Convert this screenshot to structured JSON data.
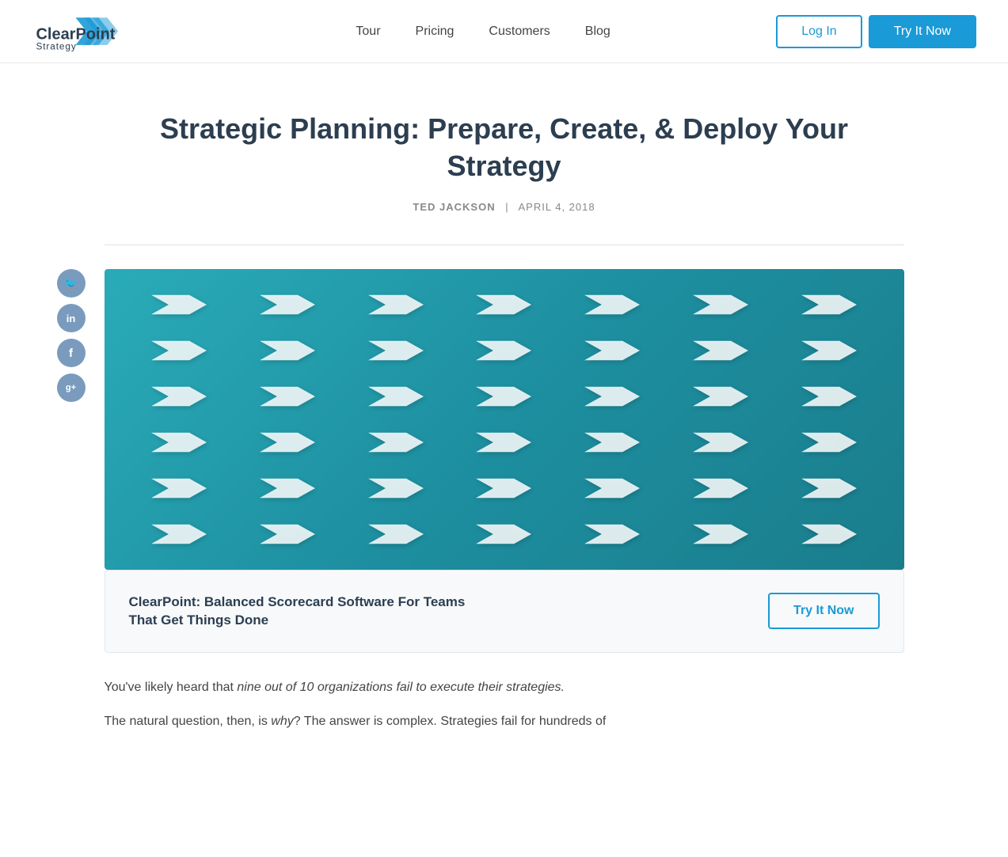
{
  "header": {
    "logo_text": "ClearPoint Strategy",
    "nav_items": [
      {
        "label": "Tour",
        "id": "tour"
      },
      {
        "label": "Pricing",
        "id": "pricing"
      },
      {
        "label": "Customers",
        "id": "customers"
      },
      {
        "label": "Blog",
        "id": "blog"
      }
    ],
    "login_label": "Log In",
    "try_label": "Try It Now"
  },
  "article": {
    "title": "Strategic Planning: Prepare, Create, & Deploy Your Strategy",
    "author": "TED JACKSON",
    "separator": "|",
    "date": "APRIL 4, 2018",
    "body_intro": "You've likely heard that ",
    "body_italic": "nine out of 10 organizations fail to execute their strategies.",
    "body_period": "",
    "body_second_line_start": "The natural question, then, is ",
    "body_second_italic": "why",
    "body_second_end": "? The answer is complex. Strategies fail for hundreds of"
  },
  "social": {
    "twitter_icon": "𝕏",
    "linkedin_icon": "in",
    "facebook_icon": "f",
    "googleplus_icon": "g+"
  },
  "cta": {
    "text_line1": "ClearPoint: Balanced Scorecard Software For Teams",
    "text_line2": "That Get Things Done",
    "button_label": "Try It Now"
  },
  "colors": {
    "brand_blue": "#1a9ad7",
    "heading_dark": "#2c3e50",
    "teal_hero": "#2aabb8"
  }
}
